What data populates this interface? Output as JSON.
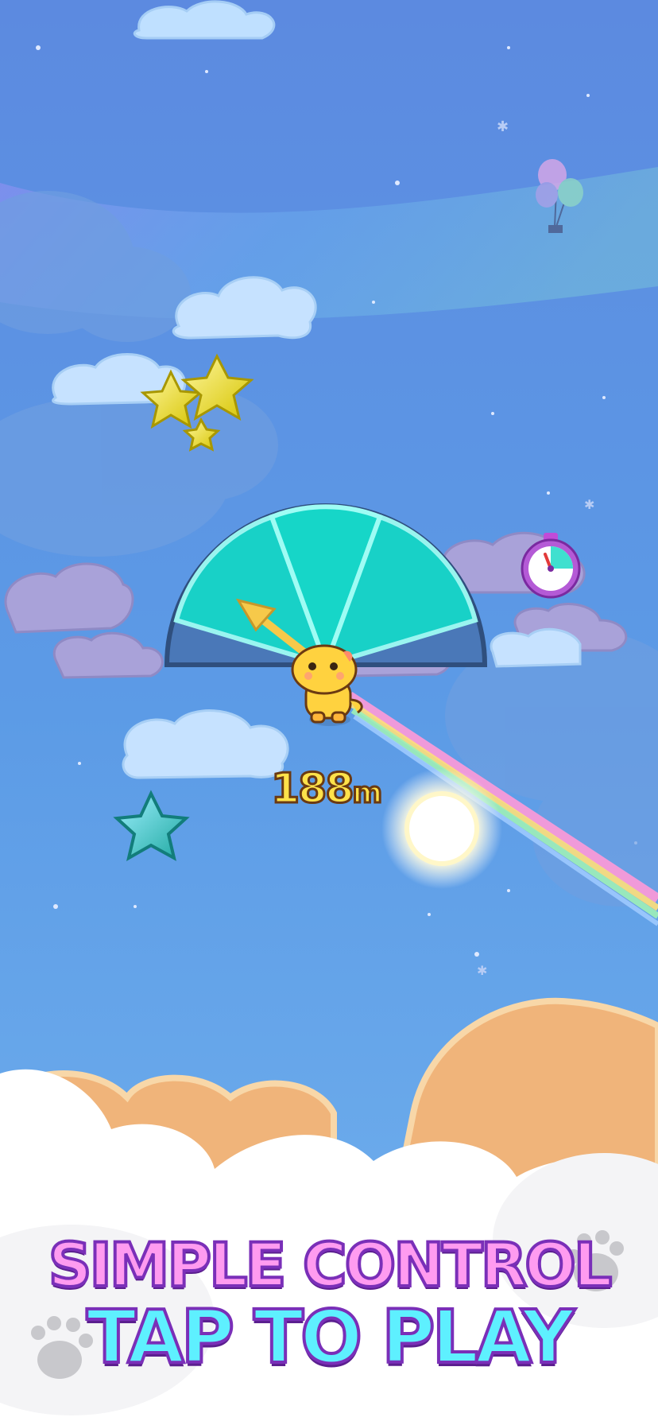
{
  "hud": {
    "distance_value": "188",
    "distance_unit": "m"
  },
  "promo": {
    "line1": "SIMPLE CONTROL",
    "line2": "TAP TO PLAY"
  },
  "icons": [
    "star-icon",
    "stopwatch-icon",
    "balloon-icon",
    "paw-icon",
    "sun-icon",
    "dino-character"
  ],
  "colors": {
    "sky_top": "#5c8fe0",
    "sky_bottom": "#6aa6ea",
    "gauge": "#16d6c8",
    "headline_pink": "#ff9bf0",
    "headline_cyan": "#5ef0ff",
    "outline_purple": "#7a2fb8"
  }
}
